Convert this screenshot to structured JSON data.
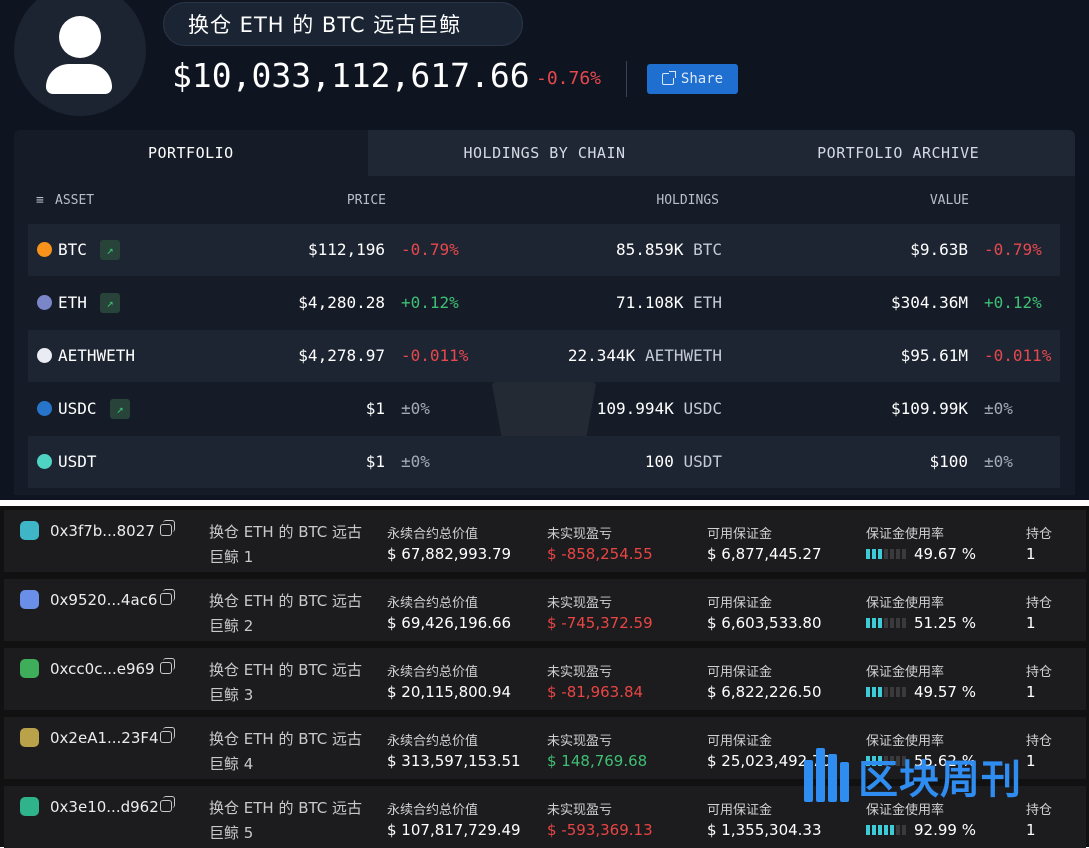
{
  "header": {
    "title": "换仓 ETH 的 BTC 远古巨鲸",
    "total_value": "$10,033,112,617.66",
    "total_change": "-0.76%",
    "share_label": "Share"
  },
  "tabs": [
    {
      "label": "PORTFOLIO",
      "active": true
    },
    {
      "label": "HOLDINGS BY CHAIN",
      "active": false
    },
    {
      "label": "PORTFOLIO ARCHIVE",
      "active": false
    }
  ],
  "columns": {
    "asset": "ASSET",
    "price": "PRICE",
    "holdings": "HOLDINGS",
    "value": "VALUE"
  },
  "assets": [
    {
      "symbol": "BTC",
      "icon": "bitcoin-icon",
      "trend": true,
      "price": "$112,196",
      "price_change": "-0.79%",
      "holdings": "85.859K",
      "holdings_unit": "BTC",
      "value": "$9.63B",
      "value_change": "-0.79%",
      "direction": "neg"
    },
    {
      "symbol": "ETH",
      "icon": "ethereum-icon",
      "trend": true,
      "price": "$4,280.28",
      "price_change": "+0.12%",
      "holdings": "71.108K",
      "holdings_unit": "ETH",
      "value": "$304.36M",
      "value_change": "+0.12%",
      "direction": "pos"
    },
    {
      "symbol": "AETHWETH",
      "icon": "aave-weth-icon",
      "trend": false,
      "price": "$4,278.97",
      "price_change": "-0.011%",
      "holdings": "22.344K",
      "holdings_unit": "AETHWETH",
      "value": "$95.61M",
      "value_change": "-0.011%",
      "direction": "neg"
    },
    {
      "symbol": "USDC",
      "icon": "usdc-icon",
      "trend": true,
      "price": "$1",
      "price_change": "±0%",
      "holdings": "109.994K",
      "holdings_unit": "USDC",
      "value": "$109.99K",
      "value_change": "±0%",
      "direction": "neu"
    },
    {
      "symbol": "USDT",
      "icon": "tether-icon",
      "trend": false,
      "price": "$1",
      "price_change": "±0%",
      "holdings": "100",
      "holdings_unit": "USDT",
      "value": "$100",
      "value_change": "±0%",
      "direction": "neu"
    }
  ],
  "positions_labels": {
    "notional": "永续合约总价值",
    "upnl": "未实现盈亏",
    "margin": "可用保证金",
    "util": "保证金使用率",
    "count": "持仓"
  },
  "positions": [
    {
      "address": "0x3f7b...8027",
      "name_line1": "换仓 ETH 的 BTC 远古",
      "name_line2": "巨鲸 1",
      "notional": "$ 67,882,993.79",
      "upnl": "$ -858,254.55",
      "upnl_dir": "neg",
      "margin": "$ 6,877,445.27",
      "util": "49.67 %",
      "util_level": 0.4967,
      "count": "1",
      "avatar_color": "#3fb6c8"
    },
    {
      "address": "0x9520...4ac6",
      "name_line1": "换仓 ETH 的 BTC 远古",
      "name_line2": "巨鲸 2",
      "notional": "$ 69,426,196.66",
      "upnl": "$ -745,372.59",
      "upnl_dir": "neg",
      "margin": "$ 6,603,533.80",
      "util": "51.25 %",
      "util_level": 0.5125,
      "count": "1",
      "avatar_color": "#6a8fe8"
    },
    {
      "address": "0xcc0c...e969",
      "name_line1": "换仓 ETH 的 BTC 远古",
      "name_line2": "巨鲸 3",
      "notional": "$ 20,115,800.94",
      "upnl": "$ -81,963.84",
      "upnl_dir": "neg",
      "margin": "$ 6,822,226.50",
      "util": "49.57 %",
      "util_level": 0.4957,
      "count": "1",
      "avatar_color": "#3fae5a"
    },
    {
      "address": "0x2eA1...23F4",
      "name_line1": "换仓 ETH 的 BTC 远古",
      "name_line2": "巨鲸 4",
      "notional": "$ 313,597,153.51",
      "upnl": "$ 148,769.68",
      "upnl_dir": "pos",
      "margin": "$ 25,023,492.70",
      "util": "55.62 %",
      "util_level": 0.5562,
      "count": "1",
      "avatar_color": "#b9a24a"
    },
    {
      "address": "0x3e10...d962",
      "name_line1": "换仓 ETH 的 BTC 远古",
      "name_line2": "巨鲸 5",
      "notional": "$ 107,817,729.49",
      "upnl": "$ -593,369.13",
      "upnl_dir": "neg",
      "margin": "$ 1,355,304.33",
      "util": "92.99 %",
      "util_level": 0.9299,
      "count": "1",
      "avatar_color": "#2fb38a"
    }
  ],
  "logo_text": "区块周刊"
}
